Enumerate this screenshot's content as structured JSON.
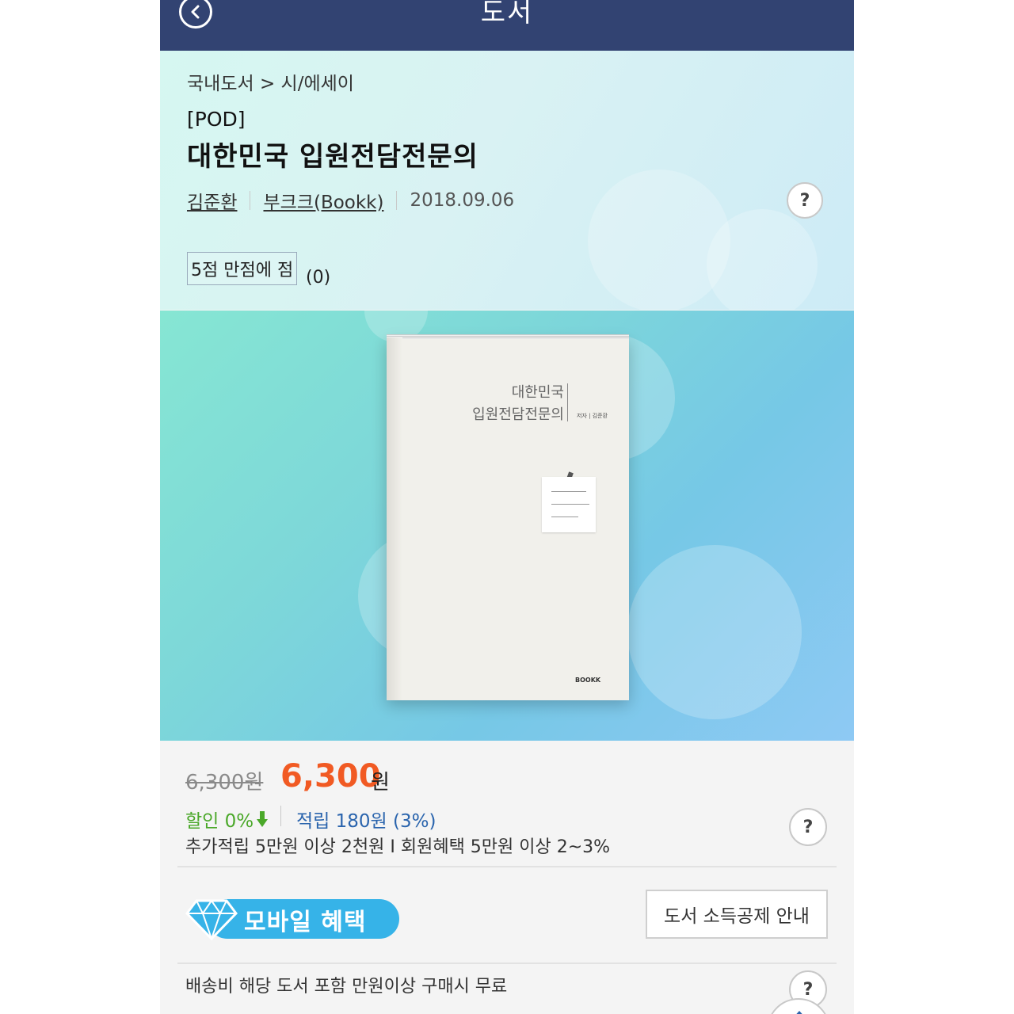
{
  "header": {
    "title": "도서",
    "back_icon": "chevron-left-icon"
  },
  "product": {
    "breadcrumb": "국내도서 > 시/에세이",
    "tag": "[POD]",
    "title": "대한민국 입원전담전문의",
    "author": "김준환",
    "publisher": "부크크(Bookk)",
    "date": "2018.09.06",
    "rating_label": "5점 만점에 점",
    "rating_count": "(0)",
    "help": "?"
  },
  "cover": {
    "title_line1": "대한민국",
    "title_line2": "입원전담전문의",
    "author": "저자 | 김준환",
    "publisher_logo": "BOOKK"
  },
  "price": {
    "original": "6,300원",
    "sale": "6,300",
    "sale_unit": "원",
    "discount": "할인 0%",
    "points": "적립 180원 (3%)",
    "extra": "추가적립 5만원 이상 2천원 I 회원혜택 5만원 이상 2~3%",
    "help": "?"
  },
  "benefits": {
    "mobile_label": "모바일 혜택",
    "tax_button": "도서 소득공제 안내"
  },
  "shipping": {
    "text": "배송비 해당 도서 포함 만원이상 구매시 무료",
    "help": "?"
  },
  "colors": {
    "header_bg": "#324372",
    "sale_price": "#f15a23",
    "discount": "#4aa829",
    "points": "#2a64ad",
    "badge": "#36b3e8"
  }
}
